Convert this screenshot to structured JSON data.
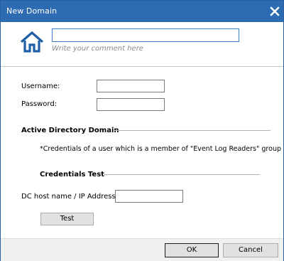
{
  "window": {
    "title": "New Domain"
  },
  "header": {
    "comment_value": "",
    "comment_hint": "Write your comment here"
  },
  "credentials": {
    "username_label": "Username:",
    "username_value": "",
    "password_label": "Password:",
    "password_value": ""
  },
  "ad_section": {
    "title": "Active Directory Domain",
    "note": "*Credentials of a user which is a member of \"Event Log Readers\" group"
  },
  "test_section": {
    "title": "Credentials Test",
    "dc_label": "DC host name / IP Address:",
    "dc_value": "",
    "test_button": "Test"
  },
  "footer": {
    "ok_label": "OK",
    "cancel_label": "Cancel"
  },
  "icons": {
    "home": "home-icon",
    "close": "close-icon"
  },
  "colors": {
    "titlebar": "#2d6bb3",
    "accent": "#3c7fd0",
    "home_icon": "#1f5ea8"
  }
}
